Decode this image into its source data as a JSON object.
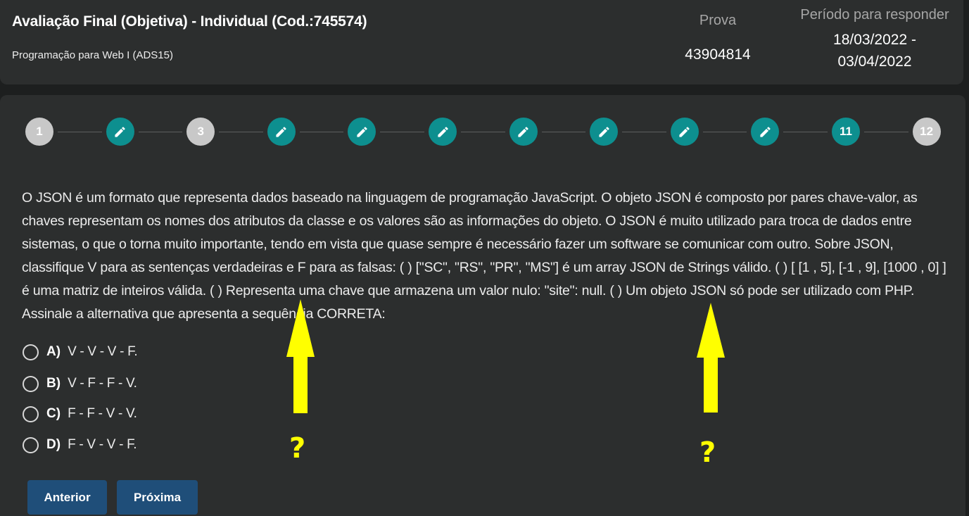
{
  "header": {
    "title": "Avaliação Final (Objetiva) - Individual (Cod.:745574)",
    "course": "Programação para Web I (ADS15)",
    "prova_label": "Prova",
    "prova_value": "43904814",
    "period_label": "Período para responder",
    "period_start": "18/03/2022 -",
    "period_end": "03/04/2022"
  },
  "stepper": {
    "steps": [
      {
        "label": "1",
        "state": "unanswered"
      },
      {
        "label": "",
        "state": "answered",
        "icon": "pencil-icon"
      },
      {
        "label": "3",
        "state": "unanswered"
      },
      {
        "label": "",
        "state": "answered",
        "icon": "pencil-icon"
      },
      {
        "label": "",
        "state": "answered",
        "icon": "pencil-icon"
      },
      {
        "label": "",
        "state": "answered",
        "icon": "pencil-icon"
      },
      {
        "label": "",
        "state": "answered",
        "icon": "pencil-icon"
      },
      {
        "label": "",
        "state": "answered",
        "icon": "pencil-icon"
      },
      {
        "label": "",
        "state": "answered",
        "icon": "pencil-icon"
      },
      {
        "label": "",
        "state": "answered",
        "icon": "pencil-icon"
      },
      {
        "label": "11",
        "state": "current"
      },
      {
        "label": "12",
        "state": "unanswered"
      }
    ]
  },
  "question": {
    "text": "O JSON é um formato que representa dados baseado na linguagem de programação JavaScript. O objeto JSON é composto por pares chave-valor, as chaves representam os nomes dos atributos da classe e os valores são as informações do objeto. O JSON é muito utilizado para troca de dados entre sistemas, o que o torna muito importante, tendo em vista que quase sempre é necessário fazer um software se comunicar com outro. Sobre JSON, classifique V para as sentenças verdadeiras e F para as falsas: ( ) [\"SC\", \"RS\", \"PR\", \"MS\"] é um array JSON de Strings válido. ( ) [ [1 , 5], [-1 , 9], [1000 , 0] ] é uma matriz de inteiros válida. ( ) Representa uma chave que armazena um valor nulo: \"site\": null. ( ) Um objeto JSON só pode ser utilizado com PHP. Assinale a alternativa que apresenta a sequência CORRETA:"
  },
  "options": [
    {
      "letter": "A)",
      "text": "V - V - V - F."
    },
    {
      "letter": "B)",
      "text": "V - F - F - V."
    },
    {
      "letter": "C)",
      "text": "F - F - V - V."
    },
    {
      "letter": "D)",
      "text": "F - V - V - F."
    }
  ],
  "buttons": {
    "previous": "Anterior",
    "next": "Próxima"
  },
  "annotations": {
    "mark1": "?",
    "mark2": "?",
    "color": "#ffff00"
  },
  "colors": {
    "background": "#1d1f1f",
    "panel": "#2c2e2e",
    "step_answered": "#0d8f8f",
    "step_unanswered": "#c8c8c8",
    "button": "#1f4e79"
  }
}
